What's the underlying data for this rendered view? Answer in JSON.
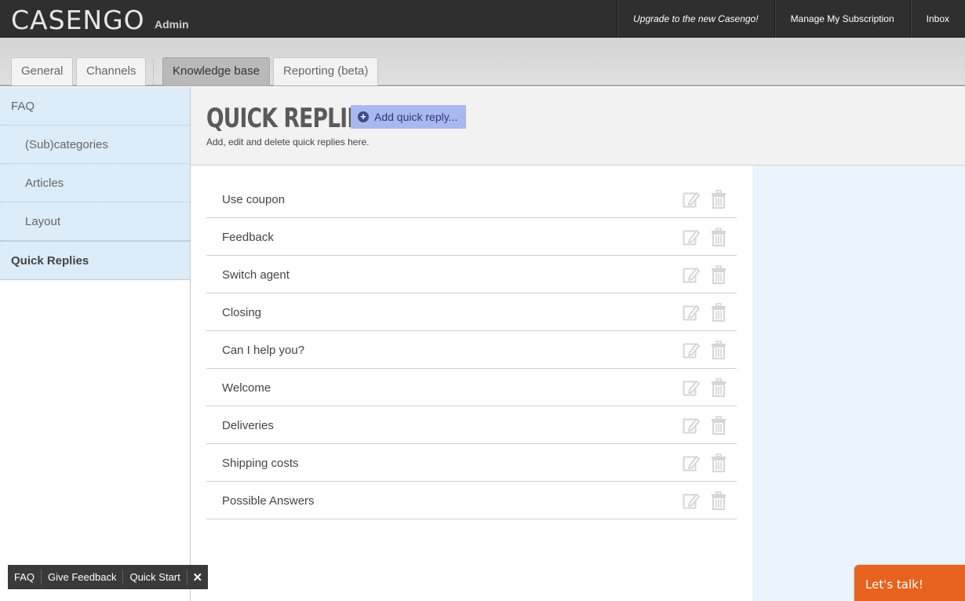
{
  "app": {
    "logo": "CASENGO",
    "logo_sub": "Admin"
  },
  "topnav": {
    "upgrade": "Upgrade to the new Casengo!",
    "subscription": "Manage My Subscription",
    "inbox": "Inbox"
  },
  "tabs": [
    {
      "label": "General"
    },
    {
      "label": "Channels"
    },
    {
      "label": "Knowledge base"
    },
    {
      "label": "Reporting (beta)"
    }
  ],
  "sidebar": {
    "items": [
      {
        "label": "FAQ"
      },
      {
        "label": "(Sub)categories"
      },
      {
        "label": "Articles"
      },
      {
        "label": "Layout"
      },
      {
        "label": "Quick Replies"
      }
    ]
  },
  "header": {
    "title": "QUICK REPLIES",
    "add_button": "Add quick reply...",
    "subtitle": "Add, edit and delete quick replies here."
  },
  "replies": [
    "Use coupon",
    "Feedback",
    "Switch agent",
    "Closing",
    "Can I help you?",
    "Welcome",
    "Deliveries",
    "Shipping costs",
    "Possible Answers"
  ],
  "helpbar": {
    "faq": "FAQ",
    "feedback": "Give Feedback",
    "quickstart": "Quick Start",
    "close": "✕"
  },
  "chat": {
    "label": "Let's talk!"
  },
  "icons": {
    "edit": "edit-icon",
    "delete": "trash-icon",
    "add": "plus-circle-icon"
  },
  "colors": {
    "accent": "#a8b8f0",
    "chat": "#e8631e",
    "sidebar": "#dcecf8",
    "topbar": "#2f2f2f"
  }
}
